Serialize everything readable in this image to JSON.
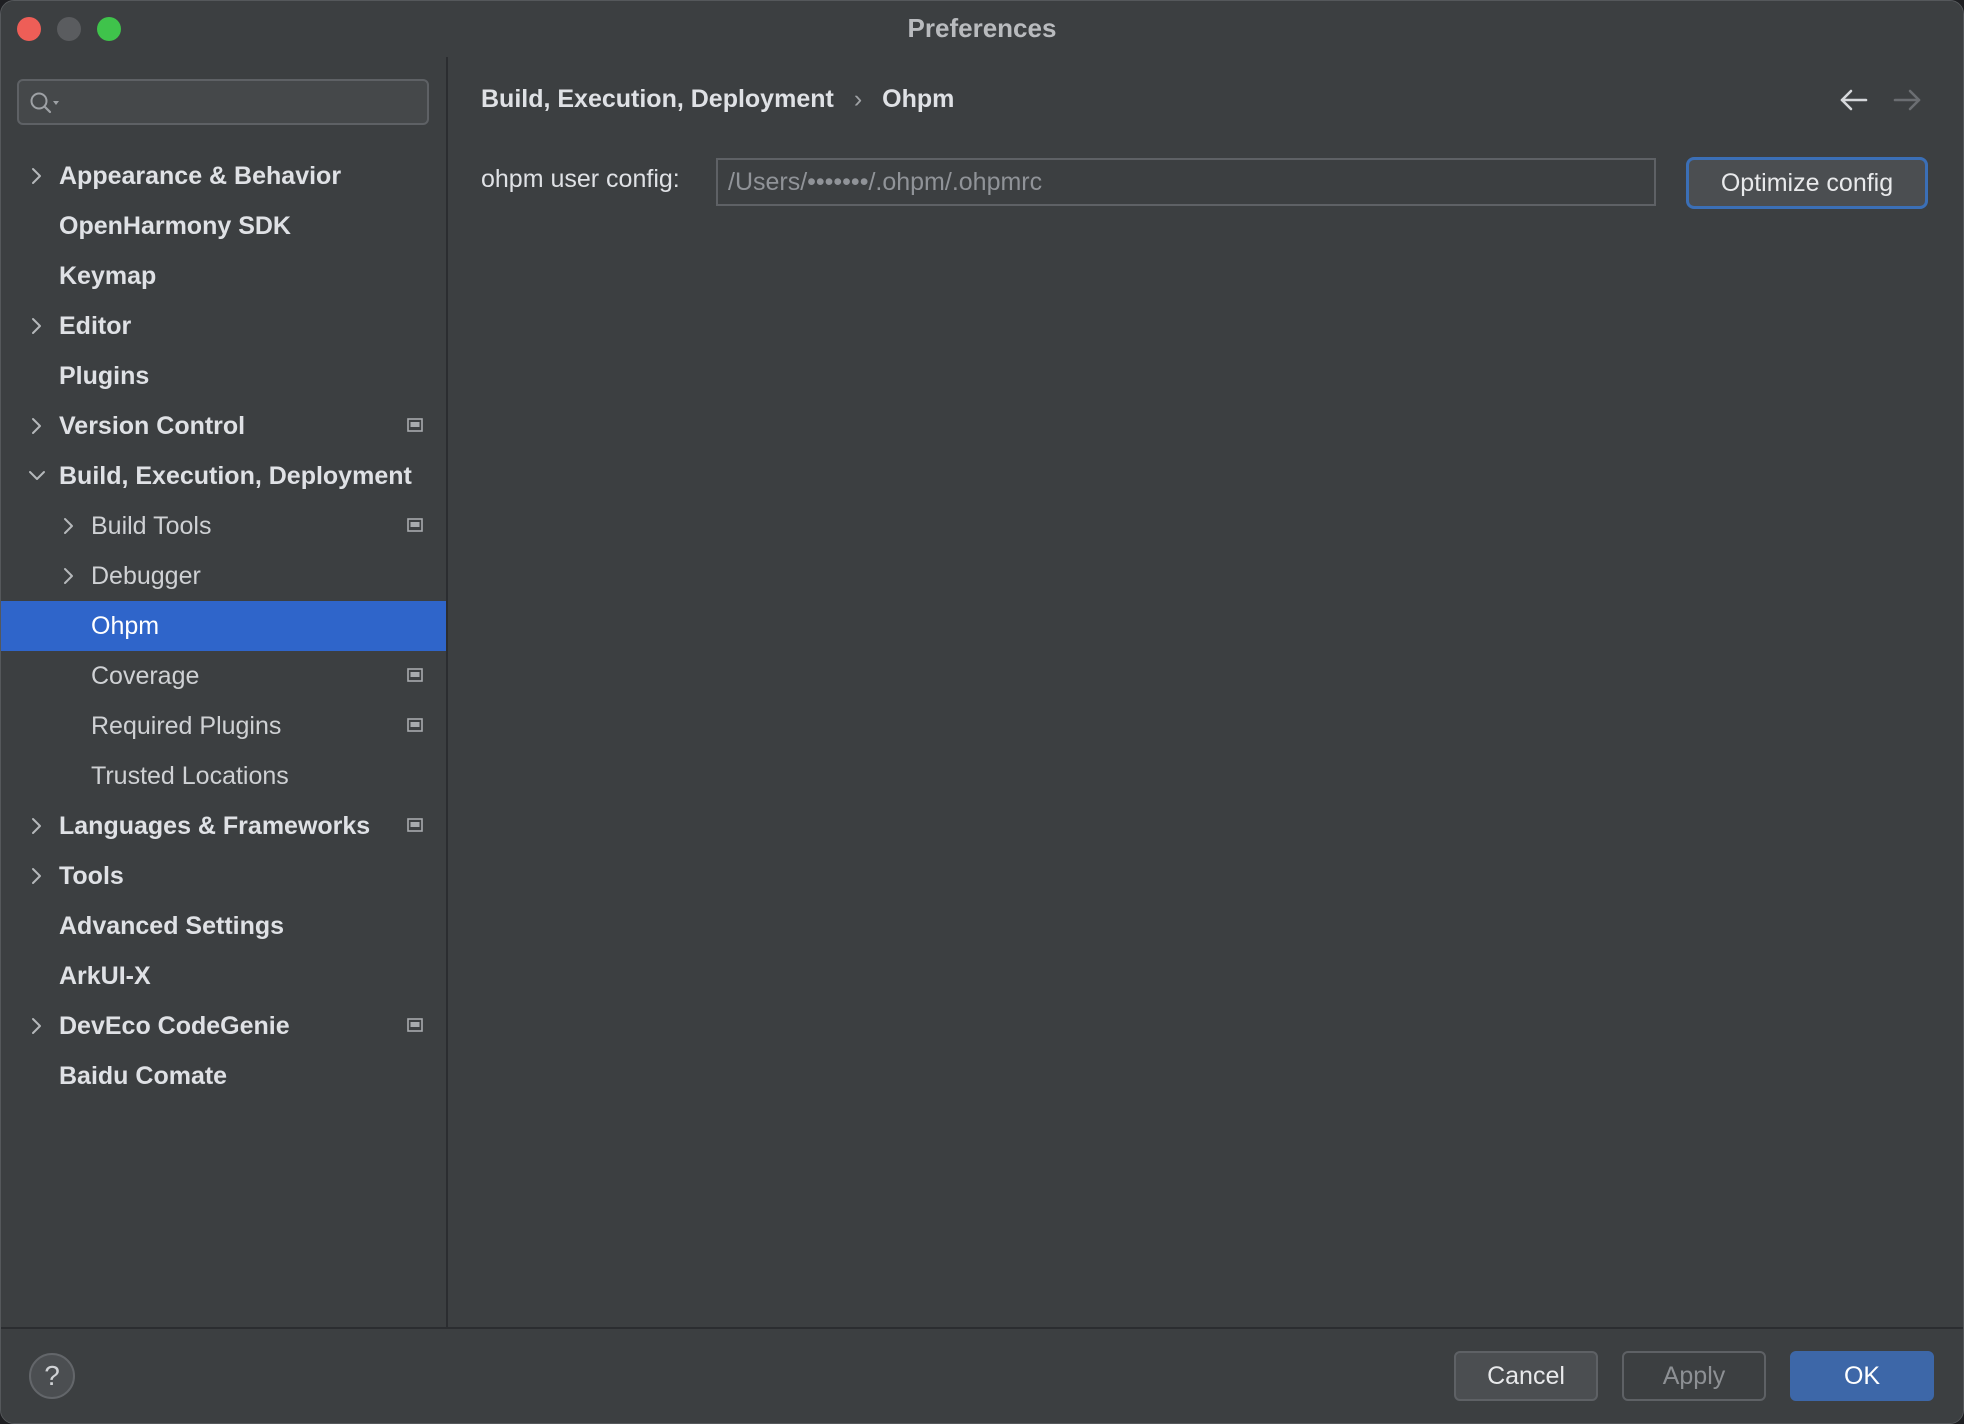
{
  "window": {
    "title": "Preferences"
  },
  "sidebar": {
    "search": {
      "value": "",
      "placeholder": ""
    },
    "items": [
      {
        "label": "Appearance & Behavior",
        "level": 0,
        "expandable": true,
        "expanded": false,
        "project_icon": false,
        "selected": false
      },
      {
        "label": "OpenHarmony SDK",
        "level": 0,
        "expandable": false,
        "project_icon": false,
        "selected": false
      },
      {
        "label": "Keymap",
        "level": 0,
        "expandable": false,
        "project_icon": false,
        "selected": false
      },
      {
        "label": "Editor",
        "level": 0,
        "expandable": true,
        "expanded": false,
        "project_icon": false,
        "selected": false
      },
      {
        "label": "Plugins",
        "level": 0,
        "expandable": false,
        "project_icon": false,
        "selected": false
      },
      {
        "label": "Version Control",
        "level": 0,
        "expandable": true,
        "expanded": false,
        "project_icon": true,
        "selected": false
      },
      {
        "label": "Build, Execution, Deployment",
        "level": 0,
        "expandable": true,
        "expanded": true,
        "project_icon": false,
        "selected": false
      },
      {
        "label": "Build Tools",
        "level": 1,
        "expandable": true,
        "expanded": false,
        "project_icon": true,
        "selected": false
      },
      {
        "label": "Debugger",
        "level": 1,
        "expandable": true,
        "expanded": false,
        "project_icon": false,
        "selected": false
      },
      {
        "label": "Ohpm",
        "level": 1,
        "expandable": false,
        "project_icon": false,
        "selected": true
      },
      {
        "label": "Coverage",
        "level": 1,
        "expandable": false,
        "project_icon": true,
        "selected": false
      },
      {
        "label": "Required Plugins",
        "level": 1,
        "expandable": false,
        "project_icon": true,
        "selected": false
      },
      {
        "label": "Trusted Locations",
        "level": 1,
        "expandable": false,
        "project_icon": false,
        "selected": false
      },
      {
        "label": "Languages & Frameworks",
        "level": 0,
        "expandable": true,
        "expanded": false,
        "project_icon": true,
        "selected": false
      },
      {
        "label": "Tools",
        "level": 0,
        "expandable": true,
        "expanded": false,
        "project_icon": false,
        "selected": false
      },
      {
        "label": "Advanced Settings",
        "level": 0,
        "expandable": false,
        "project_icon": false,
        "selected": false
      },
      {
        "label": "ArkUI-X",
        "level": 0,
        "expandable": false,
        "project_icon": false,
        "selected": false
      },
      {
        "label": "DevEco CodeGenie",
        "level": 0,
        "expandable": true,
        "expanded": false,
        "project_icon": true,
        "selected": false
      },
      {
        "label": "Baidu Comate",
        "level": 0,
        "expandable": false,
        "project_icon": false,
        "selected": false
      }
    ]
  },
  "main": {
    "breadcrumb": {
      "parent": "Build, Execution, Deployment",
      "separator": "›",
      "current": "Ohpm"
    },
    "config": {
      "label": "ohpm user config:",
      "value": "/Users/•••••••/.ohpm/.ohpmrc"
    },
    "optimize_button": "Optimize config"
  },
  "footer": {
    "help": "?",
    "cancel": "Cancel",
    "apply": "Apply",
    "ok": "OK"
  },
  "colors": {
    "selection": "#2f65ca",
    "ok_button": "#3d67a8",
    "focus_border": "#3b6fb6",
    "background": "#3c3f41"
  }
}
